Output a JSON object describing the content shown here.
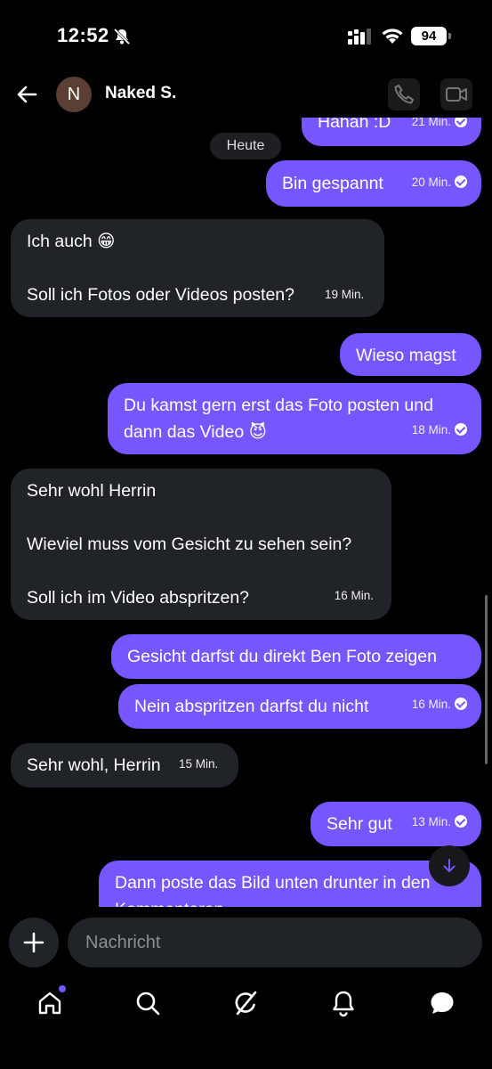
{
  "status_bar": {
    "time": "12:52",
    "battery": "94"
  },
  "header": {
    "avatar_initial": "N",
    "contact_name": "Naked S."
  },
  "date_separator": "Heute",
  "messages": [
    {
      "dir": "out",
      "text": "Hahah :D",
      "time": "21 Min."
    },
    {
      "dir": "out",
      "text": "Bin gespannt",
      "time": "20 Min."
    },
    {
      "dir": "in",
      "text": "Ich auch 😁\n\nSoll ich Fotos oder Videos posten?",
      "time": "19 Min."
    },
    {
      "dir": "out",
      "text": "Wieso magst",
      "time": ""
    },
    {
      "dir": "out",
      "text": "Du kamst gern erst das Foto posten und dann das Video 😈",
      "time": "18 Min."
    },
    {
      "dir": "in",
      "text": "Sehr wohl Herrin\n\nWieviel muss vom Gesicht zu sehen sein?\n\nSoll ich im Video abspritzen?",
      "time": "16 Min."
    },
    {
      "dir": "out",
      "text": "Gesicht darfst du direkt Ben Foto zeigen",
      "time": ""
    },
    {
      "dir": "out",
      "text": "Nein abspritzen darfst du nicht",
      "time": "16 Min."
    },
    {
      "dir": "in",
      "text": "Sehr wohl, Herrin",
      "time": "15 Min."
    },
    {
      "dir": "out",
      "text": "Sehr gut",
      "time": "13 Min."
    },
    {
      "dir": "out",
      "text": "Dann poste das Bild unten drunter in den Kommentaren",
      "time": ""
    }
  ],
  "composer": {
    "placeholder": "Nachricht"
  },
  "colors": {
    "accent": "#7856ff",
    "incoming": "#202327",
    "background": "#000000"
  },
  "tabs": [
    {
      "icon": "home-icon",
      "has_notification": true
    },
    {
      "icon": "search-icon",
      "has_notification": false
    },
    {
      "icon": "grok-icon",
      "has_notification": false
    },
    {
      "icon": "bell-icon",
      "has_notification": false
    },
    {
      "icon": "messages-icon",
      "has_notification": false
    }
  ]
}
